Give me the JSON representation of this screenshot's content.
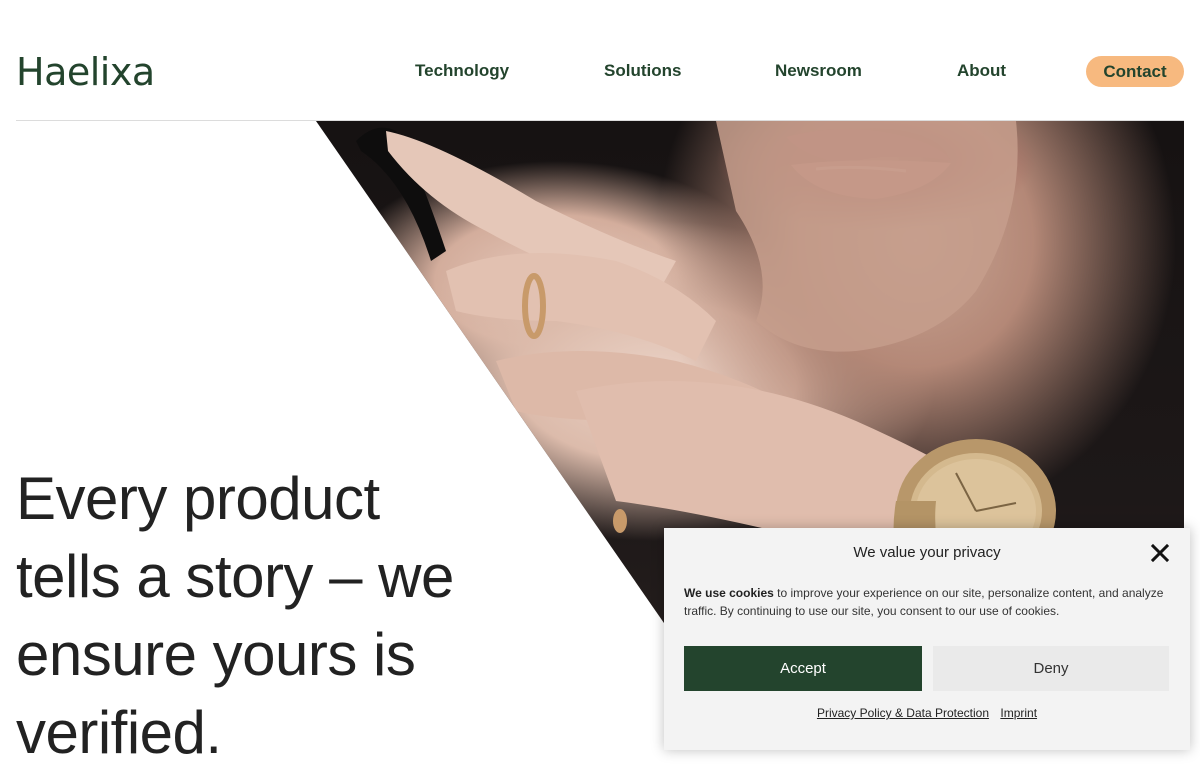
{
  "brand": {
    "logo_text": "Haelixa",
    "color": "#23442d",
    "accent": "#f7b97f"
  },
  "nav": {
    "items": [
      {
        "label": "Technology"
      },
      {
        "label": "Solutions"
      },
      {
        "label": "Newsroom"
      },
      {
        "label": "About"
      }
    ],
    "contact_label": "Contact"
  },
  "hero": {
    "headline_lines": [
      "Every product",
      "tells a story – we",
      "ensure yours is",
      "verified."
    ]
  },
  "cookie_banner": {
    "title": "We value your privacy",
    "text_bold": "We use cookies",
    "text_rest": " to improve your experience on our site, personalize content, and analyze traffic. By continuing to use our site, you consent to our use of cookies.",
    "accept_label": "Accept",
    "deny_label": "Deny",
    "privacy_link": "Privacy Policy & Data Protection",
    "imprint_link": "Imprint",
    "close_icon": "close-icon"
  }
}
